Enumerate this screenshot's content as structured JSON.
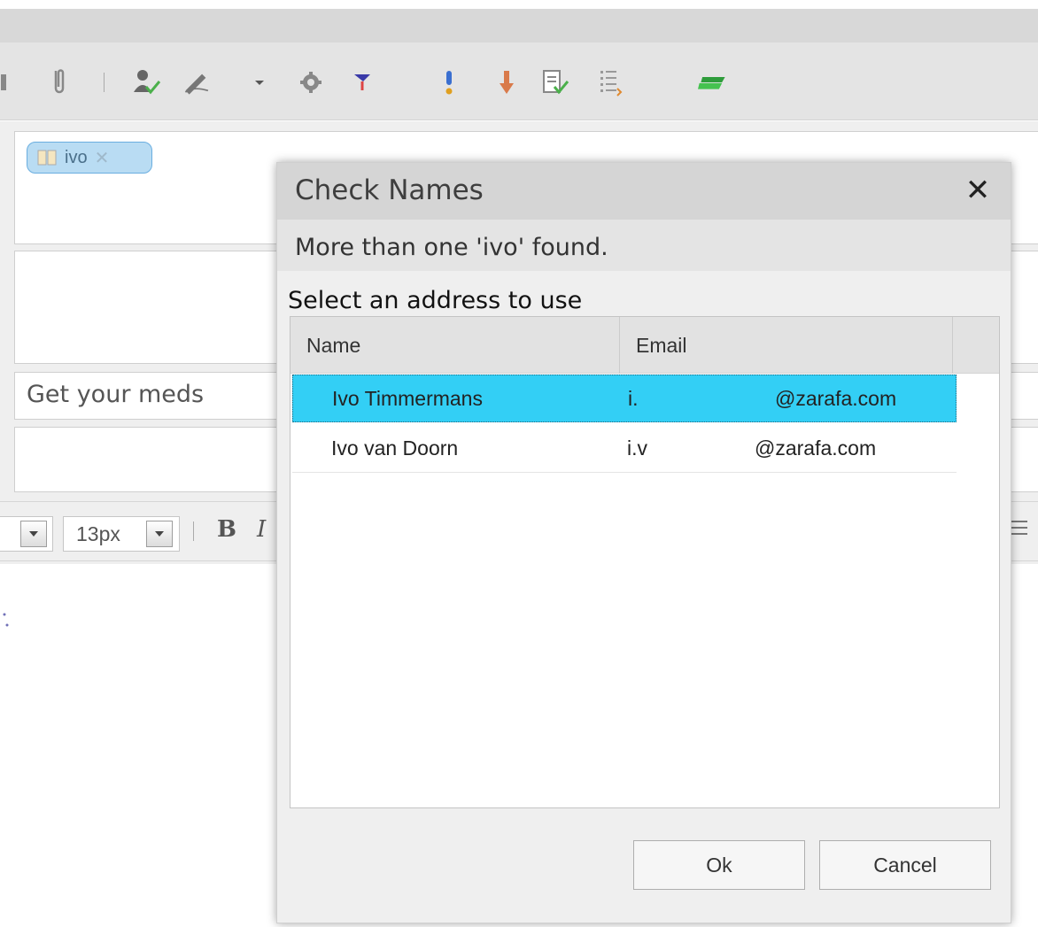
{
  "toolbar": {
    "icons": [
      "attachment-icon",
      "check-names-icon",
      "signature-icon",
      "settings-icon",
      "flag-icon",
      "high-priority-icon",
      "low-priority-icon",
      "read-receipt-icon",
      "delivery-options-icon",
      "categories-icon"
    ]
  },
  "compose": {
    "recipient_chip": "ivo",
    "subject": "Get your meds"
  },
  "format_bar": {
    "font_size": "13px",
    "bold_label": "B",
    "italic_label": "I"
  },
  "dialog": {
    "title": "Check Names",
    "message": "More than one 'ivo' found.",
    "select_label": "Select an address to use",
    "columns": {
      "name": "Name",
      "email": "Email"
    },
    "rows": [
      {
        "name": "Ivo Timmermans",
        "email_prefix": "i.",
        "email_domain": "@zarafa.com",
        "selected": true
      },
      {
        "name": "Ivo van Doorn",
        "email_prefix": "i.v",
        "email_domain": "@zarafa.com",
        "selected": false
      }
    ],
    "ok_label": "Ok",
    "cancel_label": "Cancel"
  },
  "colors": {
    "selection": "#33cff5",
    "chip_bg": "#b9dcf3"
  }
}
